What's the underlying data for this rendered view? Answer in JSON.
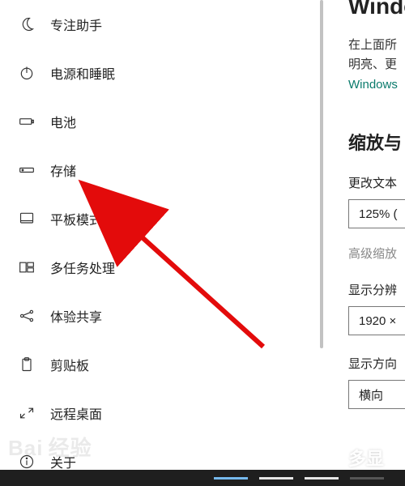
{
  "sidebar": {
    "items": [
      {
        "label": "专注助手",
        "icon": "moon-icon"
      },
      {
        "label": "电源和睡眠",
        "icon": "power-icon"
      },
      {
        "label": "电池",
        "icon": "battery-icon"
      },
      {
        "label": "存储",
        "icon": "storage-icon"
      },
      {
        "label": "平板模式",
        "icon": "tablet-icon"
      },
      {
        "label": "多任务处理",
        "icon": "multitask-icon"
      },
      {
        "label": "体验共享",
        "icon": "share-icon"
      },
      {
        "label": "剪贴板",
        "icon": "clipboard-icon"
      },
      {
        "label": "远程桌面",
        "icon": "remote-icon"
      },
      {
        "label": "关于",
        "icon": "about-icon"
      }
    ]
  },
  "main": {
    "heading_partial": "Windo",
    "desc_line1": "在上面所",
    "desc_line2": "明亮、更",
    "hd_link": "Windows",
    "section_scale": "缩放与",
    "label_text_size": "更改文本",
    "scale_value": "125% (",
    "advanced_scale": "高级缩放",
    "label_resolution": "显示分辨",
    "resolution_value": "1920 ×",
    "label_orientation": "显示方向",
    "orientation_value": "横向",
    "section_multi": "多显"
  }
}
